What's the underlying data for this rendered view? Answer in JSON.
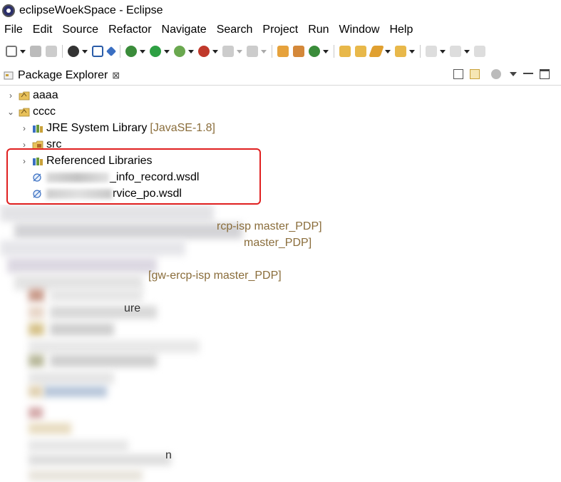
{
  "window": {
    "title": "eclipseWoekSpace - Eclipse"
  },
  "menu": [
    "File",
    "Edit",
    "Source",
    "Refactor",
    "Navigate",
    "Search",
    "Project",
    "Run",
    "Window",
    "Help"
  ],
  "view": {
    "tab_label": "Package Explorer",
    "close_glyph": "⊠"
  },
  "tree": {
    "items": [
      {
        "label": "aaaa",
        "icon": "project-icon",
        "expanded": false
      },
      {
        "label": "cccc",
        "icon": "project-icon",
        "expanded": true
      },
      {
        "label": "JRE System Library",
        "decoration": "[JavaSE-1.8]",
        "icon": "library-icon"
      },
      {
        "label": "src",
        "icon": "source-folder-icon"
      },
      {
        "label": "Referenced Libraries",
        "icon": "library-icon"
      },
      {
        "label": "_info_record.wsdl",
        "icon": "wsdl-file-icon"
      },
      {
        "label": "rvice_po.wsdl",
        "icon": "wsdl-file-icon"
      }
    ]
  },
  "obscured": {
    "labels": [
      "rcp-isp master_PDP]",
      "master_PDP]",
      "[gw-ercp-isp master_PDP]",
      "ure",
      "n"
    ]
  },
  "colors": {
    "highlight": "#e02020",
    "decoration": "#8a6d3b"
  }
}
